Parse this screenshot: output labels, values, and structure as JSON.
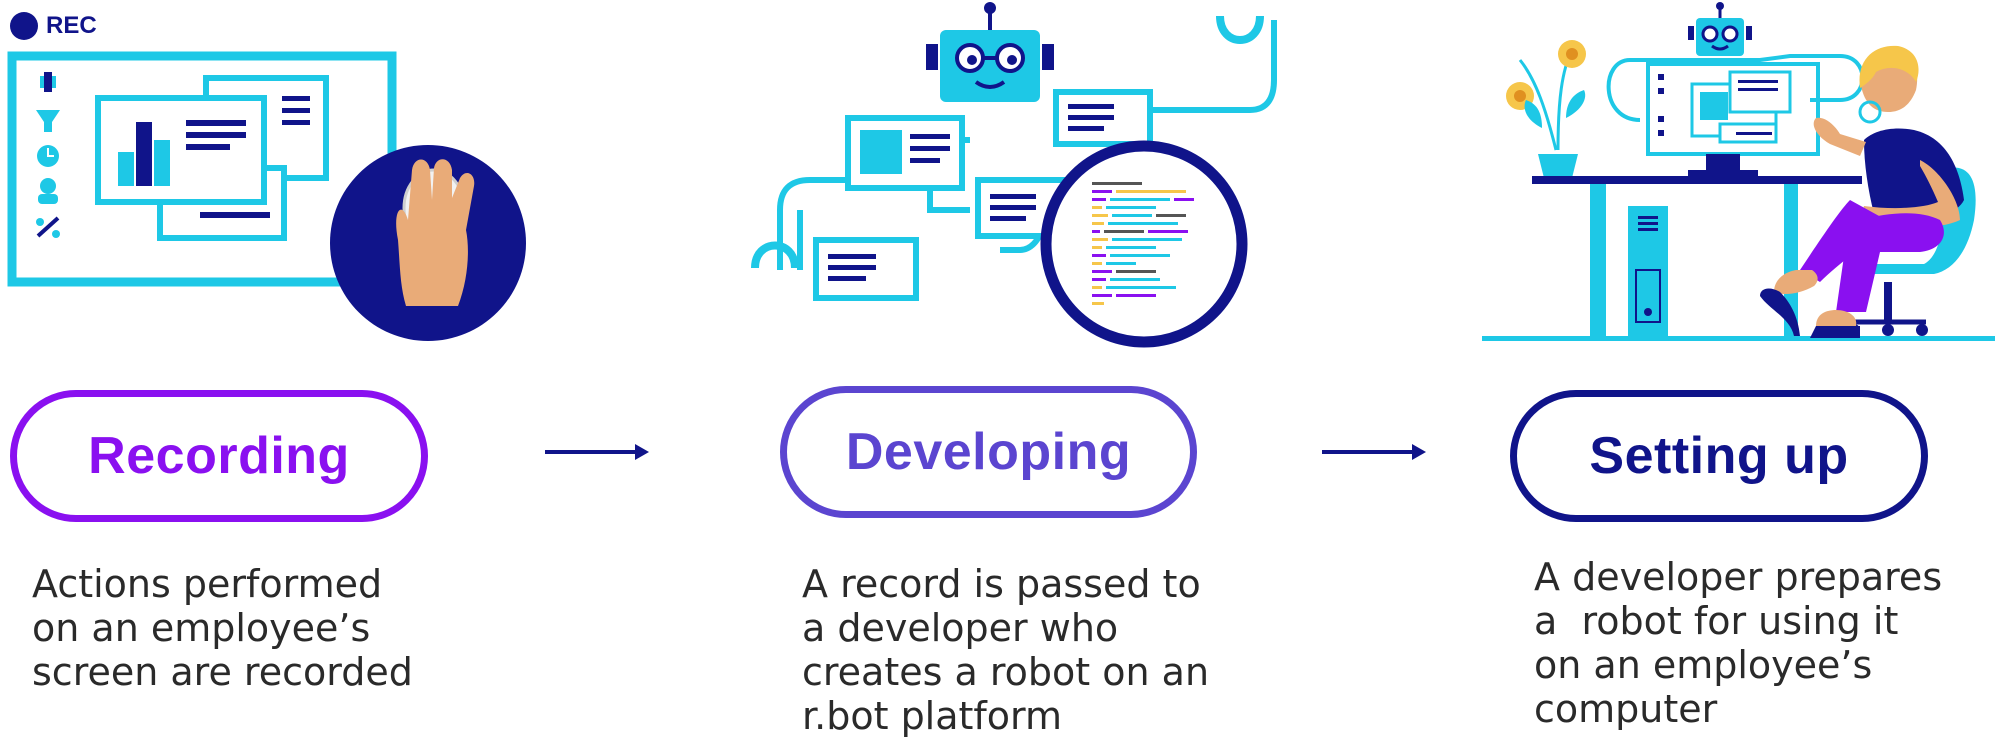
{
  "colors": {
    "cyan": "#1ec8e6",
    "navy": "#10148a",
    "purple": "#8a10f0",
    "violet": "#5b45d0",
    "skin": "#e9ab78",
    "yellow": "#f6c64a"
  },
  "rec_badge": {
    "label": "REC"
  },
  "steps": [
    {
      "title": "Recording",
      "description": [
        "Actions performed",
        "on an employee’s",
        "screen are recorded"
      ]
    },
    {
      "title": "Developing",
      "description": [
        "A record is passed to",
        "a developer who",
        "creates a robot on an",
        "r.bot platform"
      ]
    },
    {
      "title": "Setting up",
      "description": [
        "A developer prepares",
        "a  robot for using it",
        "on an employee’s",
        "computer"
      ]
    }
  ]
}
